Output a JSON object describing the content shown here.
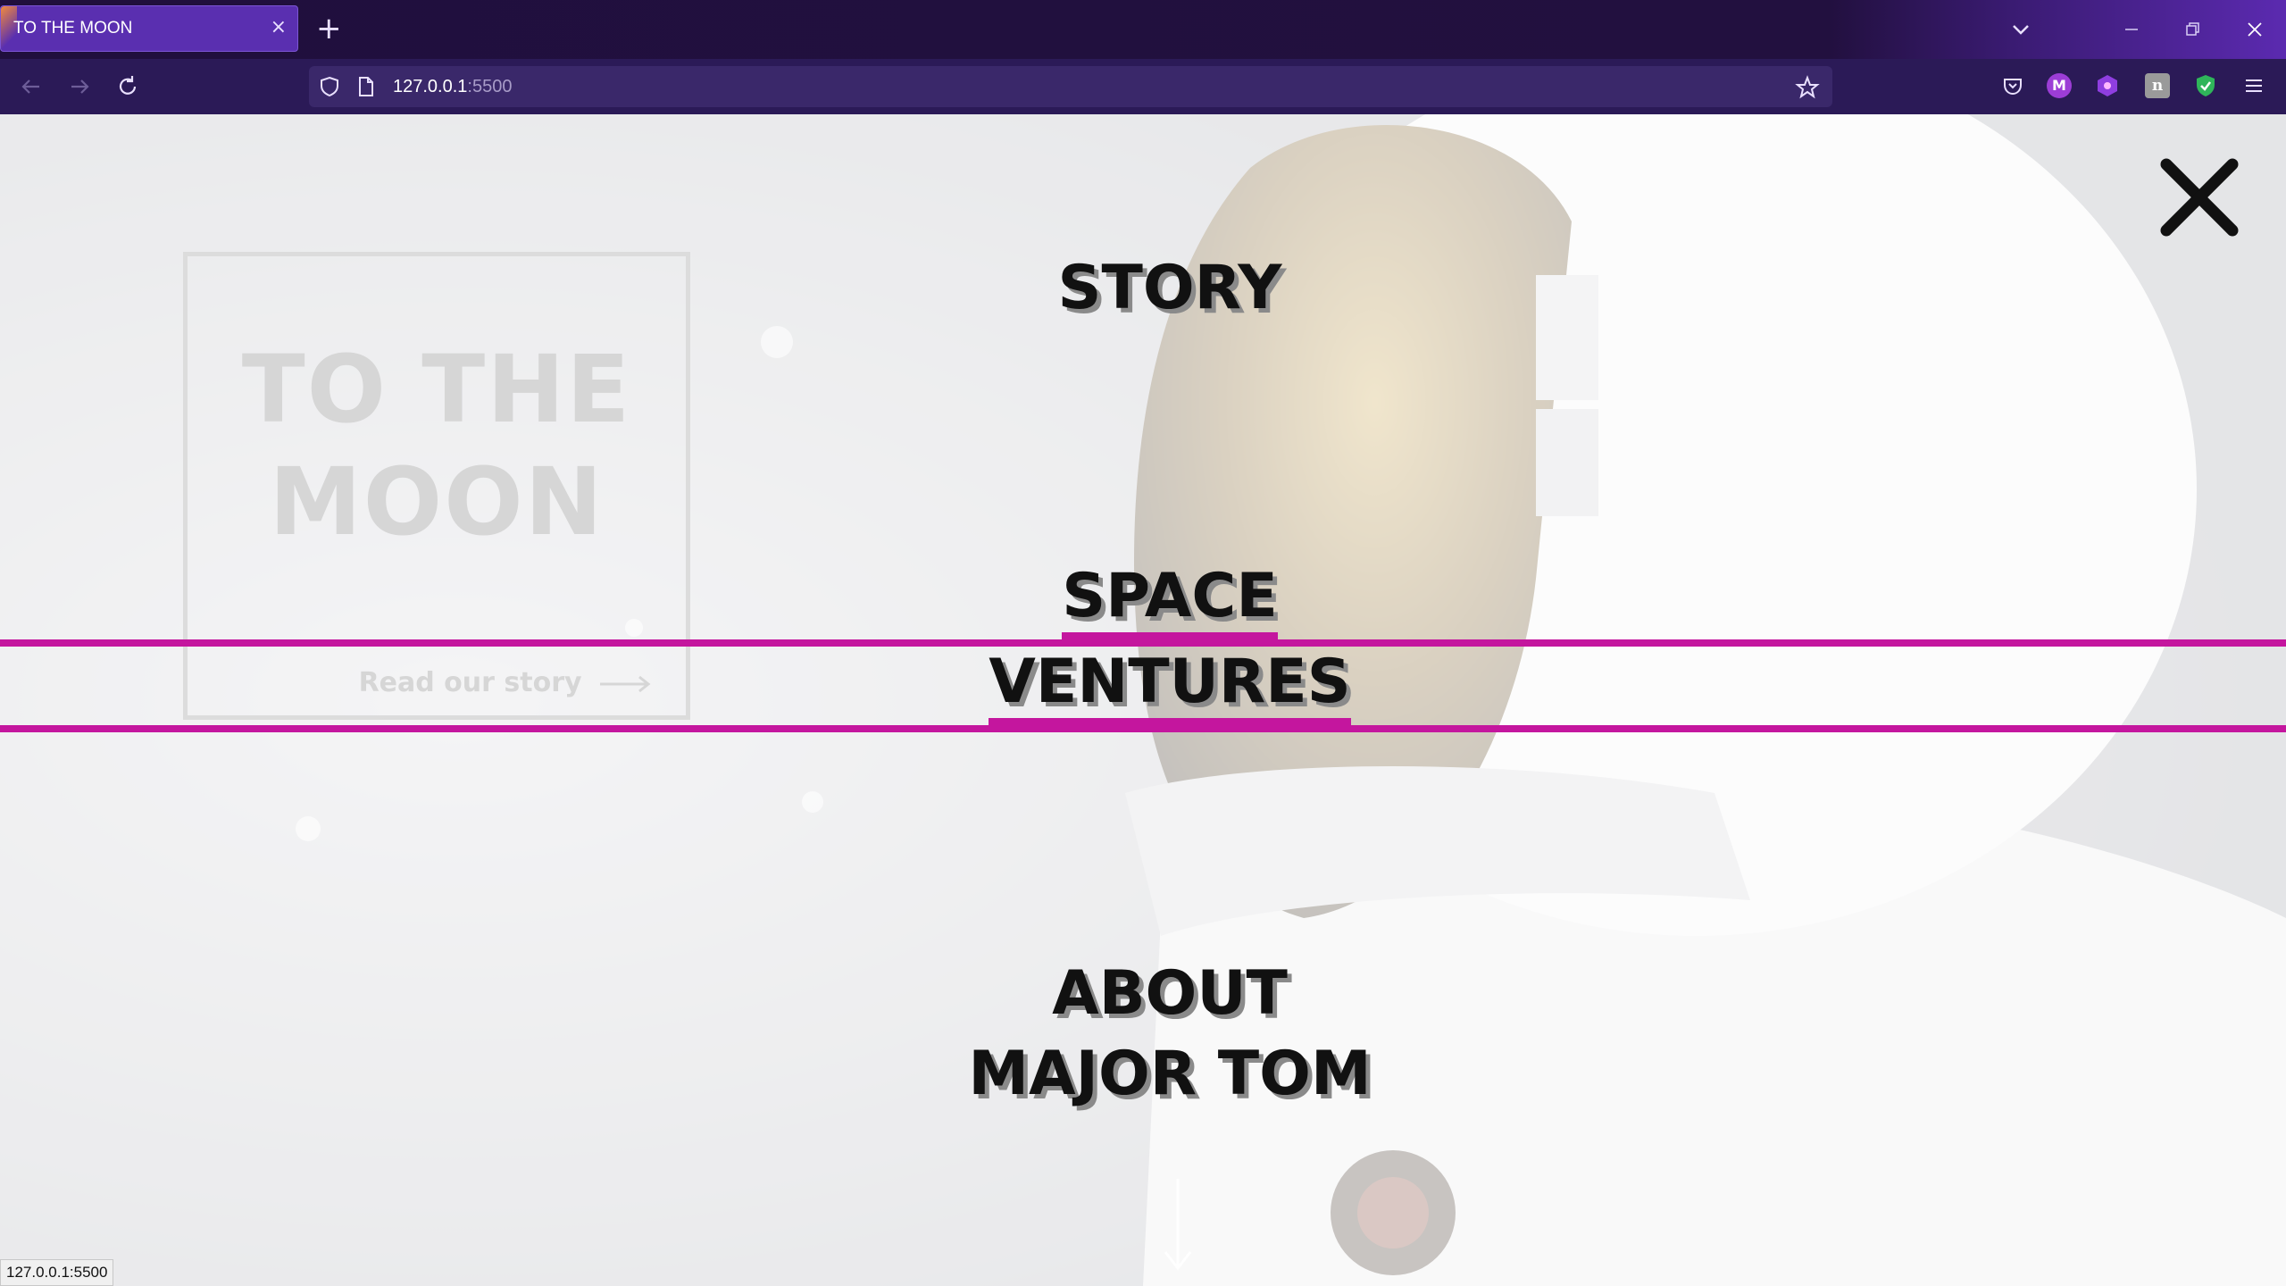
{
  "browser": {
    "tab_title": "TO THE MOON",
    "tab_close": "×",
    "new_tab": "+",
    "url_host": "127.0.0.1",
    "url_port": ":5500",
    "status_text": "127.0.0.1:5500",
    "ext_m_label": "M",
    "ext_n_label": "n"
  },
  "hero": {
    "title_line1": "TO THE",
    "title_line2": "MOON",
    "link_text": "Read our story"
  },
  "menu": {
    "items": [
      {
        "lines": [
          "STORY"
        ]
      },
      {
        "lines": [
          "SPACE",
          "VENTURES"
        ]
      },
      {
        "lines": [
          "ABOUT",
          "MAJOR TOM"
        ]
      }
    ]
  },
  "colors": {
    "accent_underline": "#c4169e",
    "tab_bg": "#5a2fb0",
    "toolbar_bg": "#2b1a57"
  }
}
